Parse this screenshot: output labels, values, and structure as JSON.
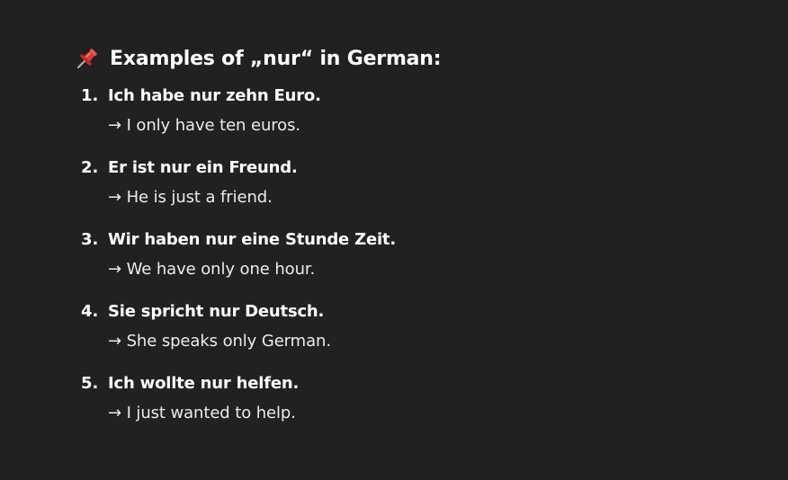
{
  "heading": {
    "icon": "pushpin-icon",
    "text": "Examples of „nur“ in German:"
  },
  "examples": [
    {
      "number": "1.",
      "german": "Ich habe nur zehn Euro.",
      "english": "→ I only have ten euros."
    },
    {
      "number": "2.",
      "german": "Er ist nur ein Freund.",
      "english": "→ He is just a friend."
    },
    {
      "number": "3.",
      "german": "Wir haben nur eine Stunde Zeit.",
      "english": "→ We have only one hour."
    },
    {
      "number": "4.",
      "german": "Sie spricht nur Deutsch.",
      "english": "→ She speaks only German."
    },
    {
      "number": "5.",
      "german": "Ich wollte nur helfen.",
      "english": "→ I just wanted to help."
    }
  ],
  "colors": {
    "background": "#212121",
    "text": "#ffffff",
    "pin": "#e53935"
  }
}
